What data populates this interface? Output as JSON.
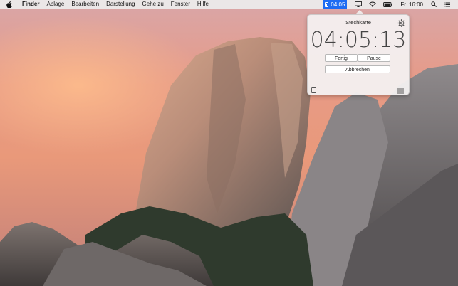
{
  "menubar": {
    "app_name": "Finder",
    "menus": [
      "Ablage",
      "Bearbeiten",
      "Darstellung",
      "Gehe zu",
      "Fenster",
      "Hilfe"
    ],
    "status_timer": "04:05",
    "clock": "Fr. 16:00"
  },
  "popover": {
    "title": "Stechkarte",
    "timer": "04:05:13",
    "done_label": "Fertig",
    "pause_label": "Pause",
    "cancel_label": "Abbrechen"
  },
  "colors": {
    "status_highlight": "#1e6cf3",
    "menubar_bg": "#ececec"
  },
  "icons": [
    "apple-icon",
    "timecard-icon",
    "airplay-icon",
    "wifi-icon",
    "battery-icon",
    "search-icon",
    "notification-list-icon",
    "gear-icon",
    "list-icon"
  ]
}
